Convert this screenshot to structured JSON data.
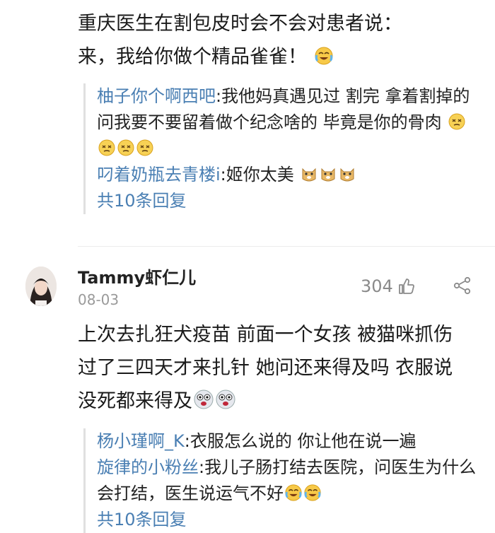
{
  "comment1": {
    "text_line1": "重庆医生在割包皮时会不会对患者说：",
    "text_line2": "来，我给你做个精品雀雀！",
    "replies": [
      {
        "user": "柚子你个啊西吧",
        "text": ":我他妈真遇见过 割完 拿着割掉的问我要不要留着做个纪念啥的 毕竟是你的骨肉"
      },
      {
        "user": "叼着奶瓶去青楼i",
        "text": ":姬你太美"
      }
    ],
    "more_replies": "共10条回复"
  },
  "comment2": {
    "username": "Tammy虾仁儿",
    "date": "08-03",
    "likes": "304",
    "text": "上次去扎狂犬疫苗 前面一个女孩 被猫咪抓伤 过了三四天才来扎针 她问还来得及吗 衣服说 没死都来得及",
    "replies": [
      {
        "user": "杨小瑾啊_K",
        "text": ":衣服怎么说的 你让他在说一遍"
      },
      {
        "user": "旋律的小粉丝",
        "text": ":我儿子肠打结去医院，问医生为什么会打结，医生说运气不好"
      }
    ],
    "more_replies": "共10条回复"
  },
  "icons": {
    "like": "thumbs-up-icon",
    "share": "share-icon",
    "emoji_laugh_cry": "laugh-cry-emoji",
    "emoji_dizzy": "dizzy-face-emoji",
    "emoji_doge": "doge-emoji",
    "emoji_shocked": "shocked-face-emoji"
  },
  "colors": {
    "username_link": "#4a7fb3",
    "text": "#1a1a1a",
    "meta": "#9a9a9a"
  }
}
